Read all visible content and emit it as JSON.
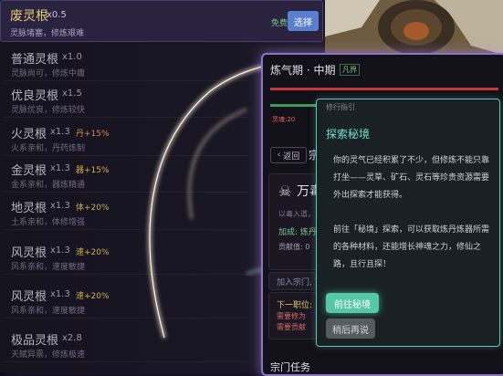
{
  "root_list": {
    "selected": {
      "name": "废灵根",
      "mult": "x0.5",
      "desc": "灵脉堵塞，修炼艰难",
      "free": "免费",
      "button": "选择"
    },
    "items": [
      {
        "name": "普通灵根",
        "mult": "x1.0",
        "bonus": "",
        "bonus_color": "",
        "desc": "灵脉尚可，修炼中庸"
      },
      {
        "name": "优良灵根",
        "mult": "x1.5",
        "bonus": "",
        "bonus_color": "",
        "desc": "灵脉优良，修炼较快"
      },
      {
        "name": "火灵根",
        "mult": "x1.3",
        "bonus": "丹+15%",
        "bonus_color": "#d08a4a",
        "desc": "火系亲和，丹药炼制"
      },
      {
        "name": "金灵根",
        "mult": "x1.3",
        "bonus": "器+15%",
        "bonus_color": "#d0b04a",
        "desc": "金系亲和，器炼精通"
      },
      {
        "name": "地灵根",
        "mult": "x1.3",
        "bonus": "体+20%",
        "bonus_color": "#c9a86a",
        "desc": "土系亲和，体修增强"
      },
      {
        "name": "风灵根",
        "mult": "x1.3",
        "bonus": "速+20%",
        "bonus_color": "#d0b04a",
        "desc": "风系亲和，速度敏捷"
      },
      {
        "name": "风灵根",
        "mult": "x1.3",
        "bonus": "速+20%",
        "bonus_color": "#d0b04a",
        "desc": "风系亲和，速度敏捷"
      },
      {
        "name": "极品灵根",
        "mult": "x2.8",
        "bonus": "",
        "bonus_color": "",
        "desc": "天赋异禀，修炼极速"
      }
    ]
  },
  "cultivation": {
    "title": "炼气期 · 中期",
    "realm_badge": "凡界",
    "soul_label": "灵魂:20",
    "back": "返回",
    "sect_label": "宗",
    "sect_name": "万毒",
    "sect_desc": "以毒入道，",
    "sect_bonus": "加成: 炼丹",
    "sect_contrib": "贡献值: 0",
    "join": "加入宗门, 可",
    "next_rank": "下一职位:",
    "req_a": "需要修为",
    "req_b": "需要贡献",
    "tasks": "宗门任务"
  },
  "guide": {
    "label": "修行指引",
    "title": "探索秘境",
    "para1": "你的灵气已经积累了不少，但修炼不能只靠打坐——灵草、矿石、灵石等珍贵资源需要外出探索才能获得。",
    "para2": "前往「秘境」探索，可以获取炼丹炼器所需的各种材料，还能增长神魂之力，修仙之路，且行且探！",
    "go_button": "前往秘境",
    "later_button": "稍后再说"
  }
}
